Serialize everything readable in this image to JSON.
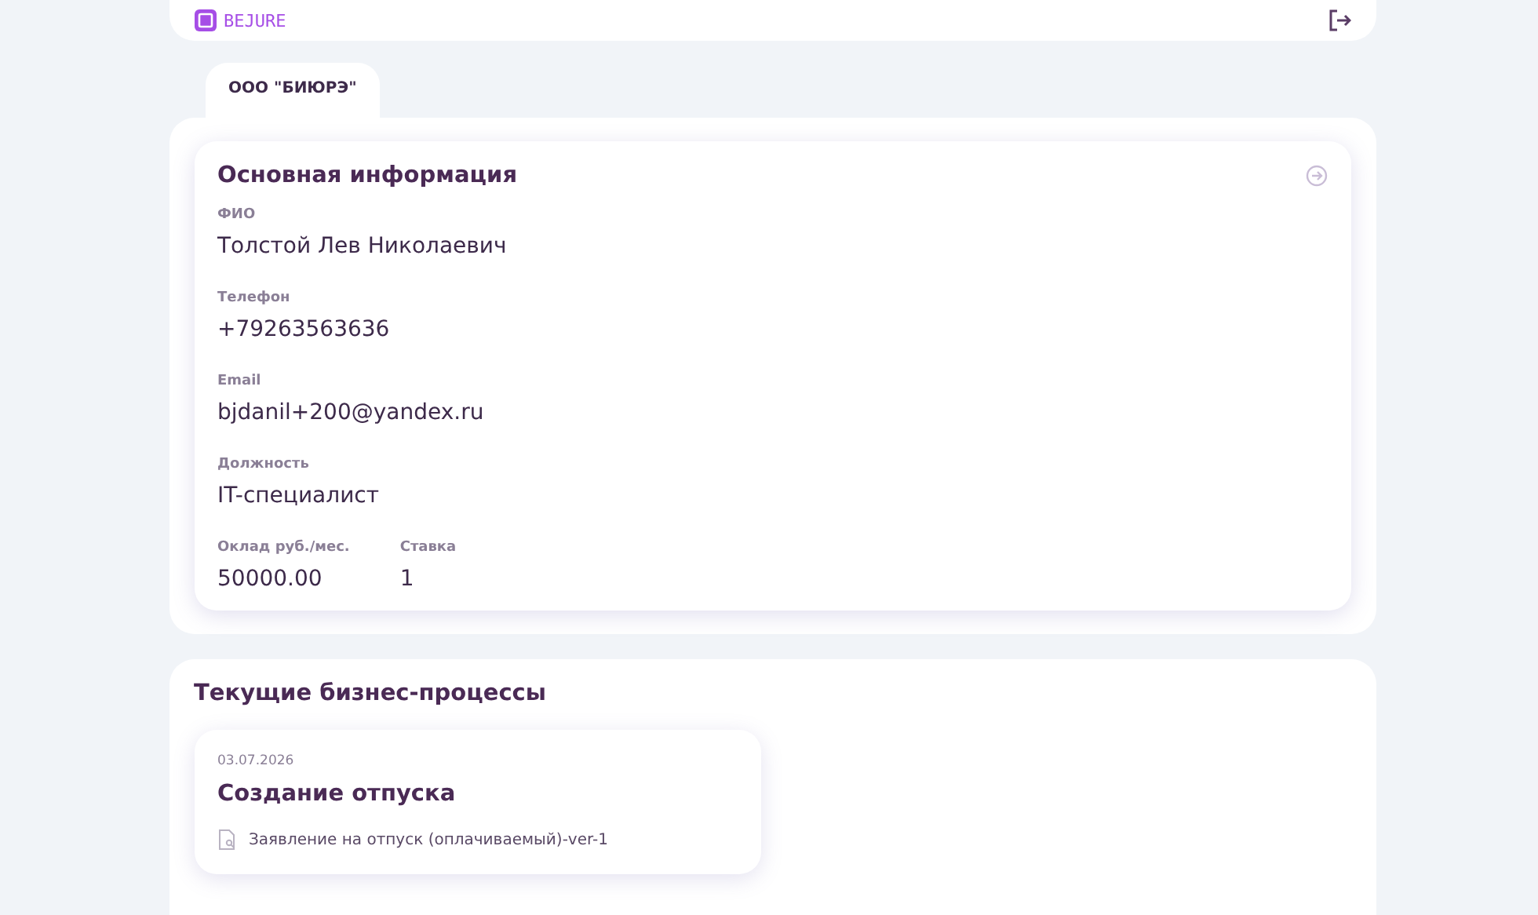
{
  "header": {
    "logo_text": "BEJURE"
  },
  "tabs": [
    {
      "label": "ООО \"БИЮРЭ\"",
      "selected": true
    }
  ],
  "info": {
    "title": "Основная информация",
    "rows": [
      [
        {
          "label": "ФИО",
          "value": "Толстой Лев Николаевич"
        }
      ],
      [
        {
          "label": "Телефон",
          "value": "+79263563636"
        }
      ],
      [
        {
          "label": "Email",
          "value": "bjdanil+200@yandex.ru"
        }
      ],
      [
        {
          "label": "Должность",
          "value": "IT-специалист"
        }
      ],
      [
        {
          "label": "Оклад руб./мес.",
          "value": "50000.00"
        },
        {
          "label": "Ставка",
          "value": "1"
        }
      ]
    ]
  },
  "processes": {
    "title": "Текущие бизнес-процессы",
    "items": [
      {
        "date": "03.07.2026",
        "title": "Создание отпуска",
        "documents": [
          "Заявление на отпуск (оплачиваемый)-ver-1"
        ]
      }
    ]
  }
}
